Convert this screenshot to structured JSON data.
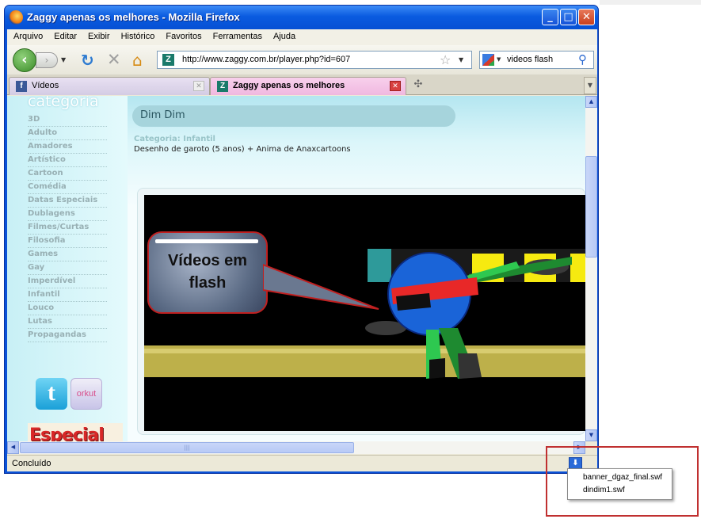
{
  "window": {
    "title": "Zaggy apenas os melhores - Mozilla Firefox"
  },
  "menu": [
    "Arquivo",
    "Editar",
    "Exibir",
    "Histórico",
    "Favoritos",
    "Ferramentas",
    "Ajuda"
  ],
  "nav": {
    "url": "http://www.zaggy.com.br/player.php?id=607",
    "search_value": "videos flash"
  },
  "tabs": [
    {
      "label": "Vídeos",
      "icon": "facebook-icon"
    },
    {
      "label": "Zaggy apenas os melhores",
      "icon": "zaggy-icon",
      "active": true
    }
  ],
  "sidebar": {
    "title": "categoria",
    "categories": [
      "3D",
      "Adulto",
      "Amadores",
      "Artístico",
      "Cartoon",
      "Comédia",
      "Datas Especiais",
      "Dublagens",
      "Filmes/Curtas",
      "Filosofia",
      "Games",
      "Gay",
      "Imperdível",
      "Infantil",
      "Louco",
      "Lutas",
      "Propagandas"
    ],
    "twitter_label": "t",
    "orkut_label": "orkut",
    "banner_text": "Especial"
  },
  "video": {
    "title": "Dim Dim",
    "category": "Categoria: Infantil",
    "description": "Desenho de garoto (5 anos) + Anima de Anaxcartoons",
    "overlay_line1": "Vídeos em",
    "overlay_line2": "flash"
  },
  "status": {
    "text": "Concluído"
  },
  "downloads": [
    "banner_dgaz_final.swf",
    "dindim1.swf"
  ],
  "colors": {
    "titlebar": "#0a5be0",
    "accent_red": "#c03030",
    "sidebar_bg": "#c8f0f6"
  }
}
